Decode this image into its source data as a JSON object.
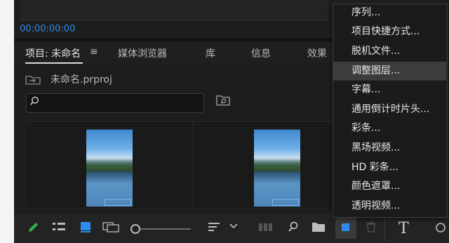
{
  "timecode": "00:00:00:00",
  "tabs": [
    {
      "label": "项目: 未命名",
      "active": true
    },
    {
      "label": "媒体浏览器"
    },
    {
      "label": "库"
    },
    {
      "label": "信息"
    },
    {
      "label": "效果"
    }
  ],
  "tab_menu_icon": "≡",
  "project": {
    "filename": "未命名.prproj"
  },
  "search": {
    "placeholder": "",
    "value": ""
  },
  "context_menu": {
    "items": [
      {
        "label": "序列..."
      },
      {
        "label": "项目快捷方式..."
      },
      {
        "label": "脱机文件..."
      },
      {
        "label": "调整图层...",
        "highlighted": true
      },
      {
        "label": "字幕..."
      },
      {
        "label": "通用倒计时片头..."
      },
      {
        "label": "彩条..."
      },
      {
        "label": "黑场视频..."
      },
      {
        "label": "HD 彩条..."
      },
      {
        "label": "颜色遮罩..."
      },
      {
        "label": "透明视频..."
      }
    ]
  },
  "toolbar": {
    "icons": [
      "pencil-icon",
      "list-view-icon",
      "icon-view-icon",
      "freeform-view-icon",
      "zoom-slider",
      "sort-icon",
      "chevron-down-icon",
      "automate-icon",
      "search-icon",
      "new-bin-icon",
      "new-item-icon",
      "trash-icon"
    ],
    "type_tool_label": "T"
  },
  "colors": {
    "accent": "#2d8ceb",
    "menu_highlight": "#3c3c3c",
    "pencil": "#2fb34a"
  }
}
